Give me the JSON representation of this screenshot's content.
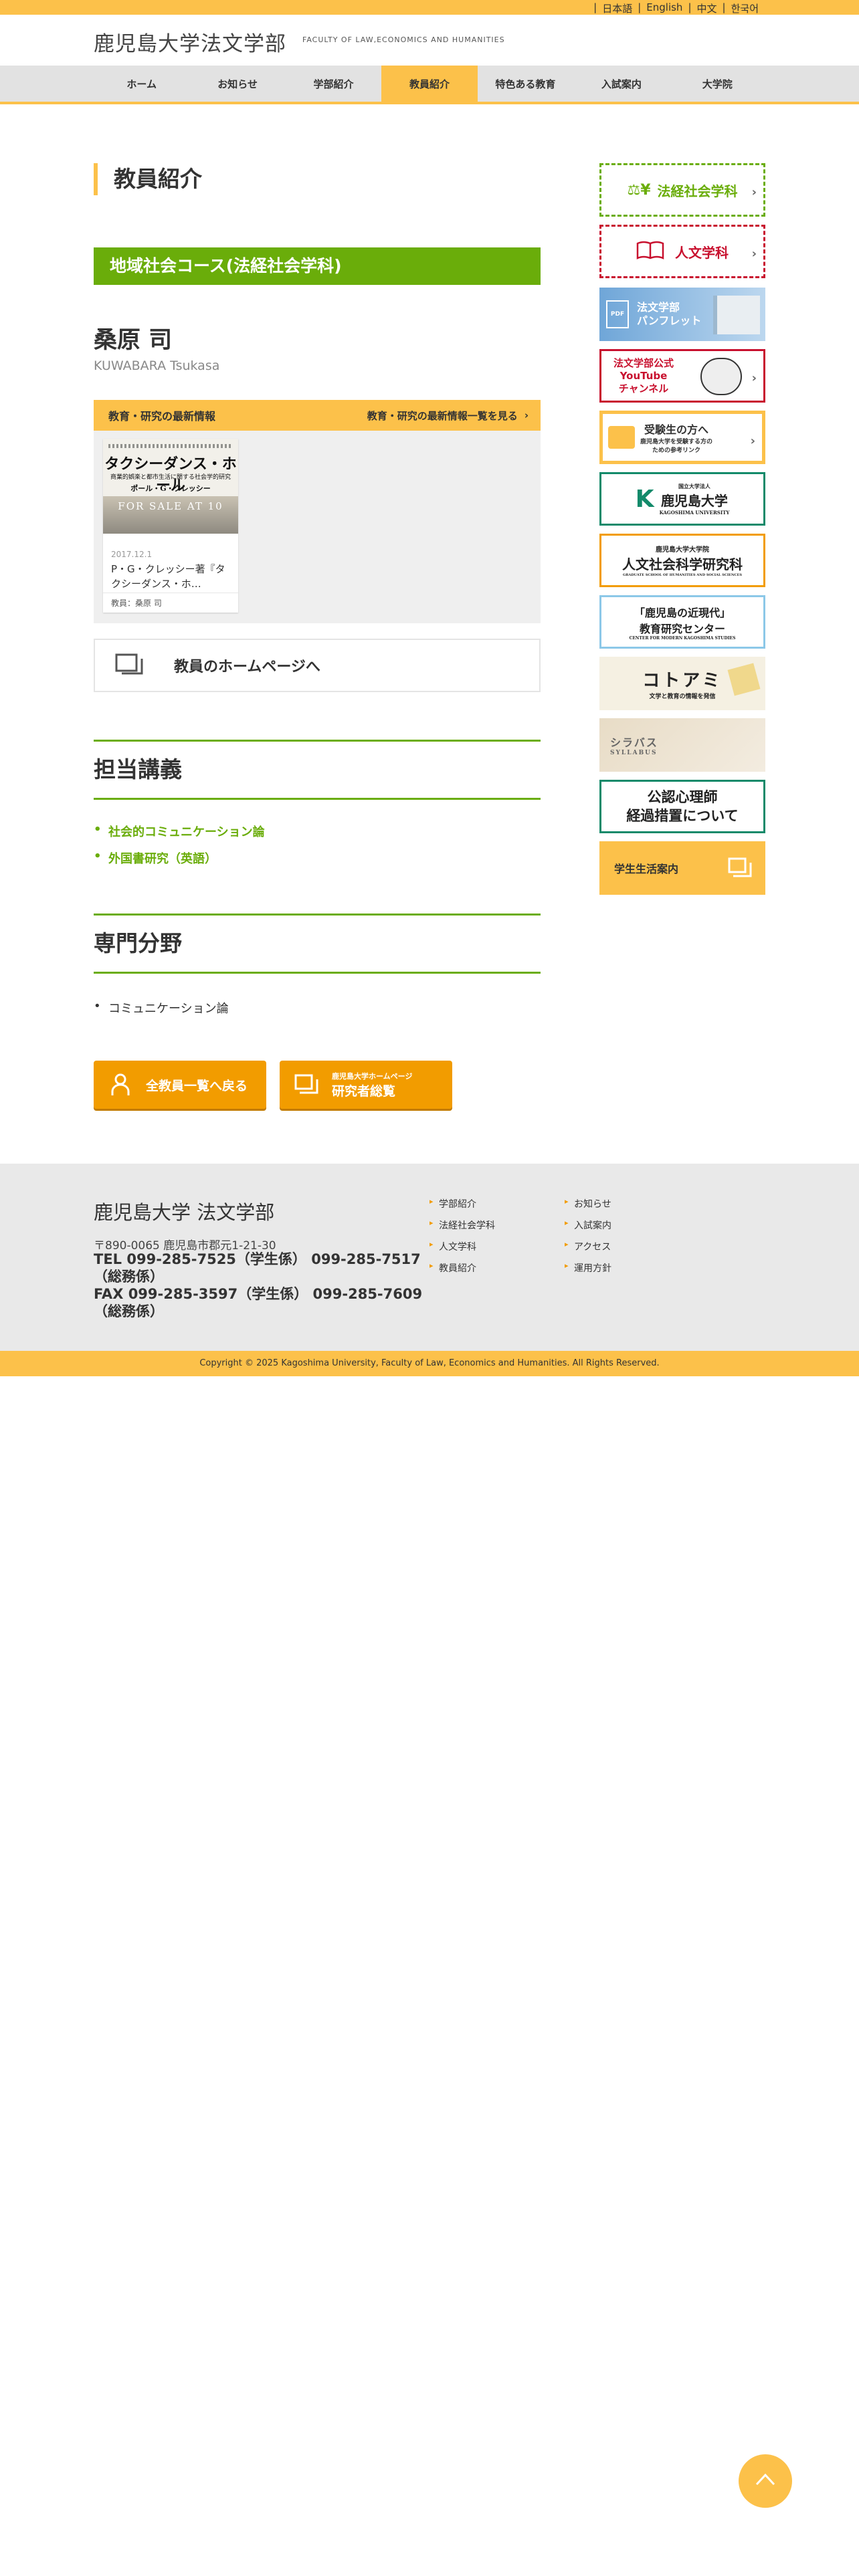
{
  "languages": [
    "日本語",
    "English",
    "中文",
    "한국어"
  ],
  "header": {
    "logo_ja": "鹿児島大学法文学部",
    "logo_en": "FACULTY OF LAW,ECONOMICS AND HUMANITIES"
  },
  "nav": [
    {
      "label": "ホーム"
    },
    {
      "label": "お知らせ"
    },
    {
      "label": "学部紹介"
    },
    {
      "label": "教員紹介",
      "active": true
    },
    {
      "label": "特色ある教育"
    },
    {
      "label": "入試案内"
    },
    {
      "label": "大学院"
    }
  ],
  "main": {
    "page_title": "教員紹介",
    "course": "地域社会コース(法経社会学科)",
    "name_ja": "桑原 司",
    "name_en": "KUWABARA Tsukasa",
    "news": {
      "heading": "教育・研究の最新情報",
      "more_label": "教育・研究の最新情報一覧を見る",
      "card": {
        "book_title": "タクシーダンス・ホール",
        "book_subtitle": "商業的娯楽と都市生活に関する社会学的研究",
        "book_author": "ポール・G・クレッシー",
        "book_banner": "FOR SALE AT 10",
        "date": "2017.12.1",
        "title": "P・G・クレッシー著『タクシーダンス・ホ…",
        "author": "教員：桑原 司"
      }
    },
    "homepage_label": "教員のホームページへ",
    "lectures_heading": "担当講義",
    "lectures": [
      "社会的コミュニケーション論",
      "外国書研究（英語）"
    ],
    "fields_heading": "専門分野",
    "fields": [
      "コミュニケーション論"
    ],
    "buttons": {
      "back_label": "全教員一覧へ戻る",
      "research_small": "鹿児島大学ホームページ",
      "research_label": "研究者総覧"
    }
  },
  "sidebar": {
    "law_dept": "法経社会学科",
    "humanities_dept": "人文学科",
    "pamphlet_line1": "法文学部",
    "pamphlet_line2": "パンフレット",
    "youtube_line1": "法文学部公式",
    "youtube_line2": "YouTube",
    "youtube_line3": "チャンネル",
    "exam_line1": "受験生の方へ",
    "exam_line2": "鹿児島大学を受験する方の",
    "exam_line3": "ための参考リンク",
    "univ_small": "国立大学法人",
    "univ_name": "鹿児島大学",
    "univ_en": "KAGOSHIMA UNIVERSITY",
    "grad_line1": "鹿児島大学大学院",
    "grad_line2": "人文社会科学研究科",
    "grad_en": "GRADUATE SCHOOL OF HUMANITIES AND SOCIAL SCIENCES",
    "center_line1": "「鹿児島の近現代」",
    "center_line2": "教育研究センター",
    "center_en": "CENTER FOR MODERN KAGOSHIMA STUDIES",
    "kotoami_title": "コトアミ",
    "kotoami_sub": "文学と教育の情報を発信",
    "syllabus_ja": "シラバス",
    "syllabus_en": "SYLLABUS",
    "psych_line1": "公認心理師",
    "psych_line2": "経過措置について",
    "student_life": "学生生活案内"
  },
  "footer": {
    "logo": "鹿児島大学 法文学部",
    "address": "〒890-0065 鹿児島市郡元1-21-30",
    "tel": "TEL 099-285-7525（学生係） 099-285-7517（総務係）",
    "fax": "FAX 099-285-3597（学生係） 099-285-7609（総務係）",
    "links_col1": [
      "学部紹介",
      "法経社会学科",
      "人文学科",
      "教員紹介"
    ],
    "links_col2": [
      "お知らせ",
      "入試案内",
      "アクセス",
      "運用方針"
    ]
  },
  "copyright": "Copyright © 2025 Kagoshima University, Faculty of Law, Economics and Humanities. All Rights Reserved.",
  "colors": {
    "accent_yellow": "#fcc14a",
    "green": "#6aad0a",
    "orange": "#f29c00",
    "red": "#c8102e",
    "teal": "#138a6a"
  }
}
